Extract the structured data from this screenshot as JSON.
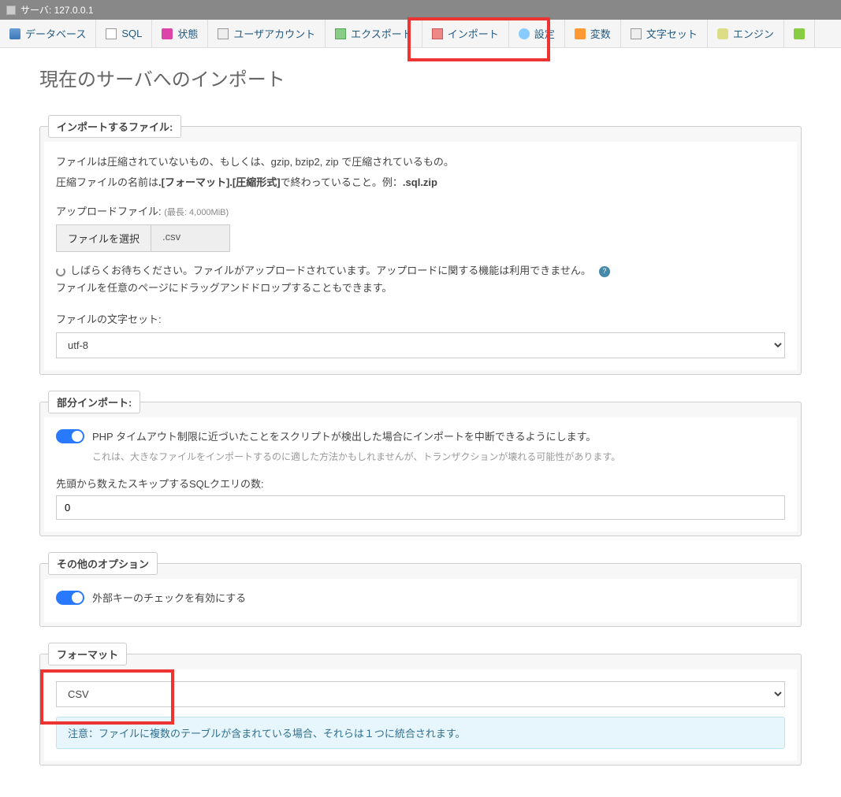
{
  "server": {
    "label": "サーバ",
    "host": "127.0.0.1"
  },
  "tabs": {
    "database": "データベース",
    "sql": "SQL",
    "status": "状態",
    "users": "ユーザアカウント",
    "export": "エクスポート",
    "import": "インポート",
    "settings": "設定",
    "variables": "変数",
    "charset": "文字セット",
    "engine": "エンジン"
  },
  "page": {
    "title": "現在のサーバへのインポート"
  },
  "file_section": {
    "legend": "インポートするファイル:",
    "desc1": "ファイルは圧縮されていないもの、もしくは、gzip, bzip2, zip で圧縮されているもの。",
    "desc2_pre": "圧縮ファイルの名前は",
    "desc2_bold": ".[フォーマット].[圧縮形式]",
    "desc2_mid": "で終わっていること。例：",
    "desc2_example": ".sql.zip",
    "upload_label": "アップロードファイル:",
    "upload_hint": "(最長: 4,000MiB)",
    "choose_btn": "ファイルを選択",
    "chosen_file": ".csv",
    "uploading_msg": "しばらくお待ちください。ファイルがアップロードされています。アップロードに関する機能は利用できません。",
    "dragdrop_msg": "ファイルを任意のページにドラッグアンドドロップすることもできます。",
    "charset_label": "ファイルの文字セット:",
    "charset_value": "utf-8"
  },
  "partial_section": {
    "legend": "部分インポート:",
    "toggle_label": "PHP タイムアウト制限に近づいたことをスクリプトが検出した場合にインポートを中断できるようにします。",
    "toggle_hint": "これは、大きなファイルをインポートするのに適した方法かもしれませんが、トランザクションが壊れる可能性があります。",
    "skip_label": "先頭から数えたスキップするSQLクエリの数:",
    "skip_value": "0"
  },
  "other_section": {
    "legend": "その他のオプション",
    "fk_label": "外部キーのチェックを有効にする"
  },
  "format_section": {
    "legend": "フォーマット",
    "value": "CSV",
    "notice": "注意：ファイルに複数のテーブルが含まれている場合、それらは１つに統合されます。"
  }
}
